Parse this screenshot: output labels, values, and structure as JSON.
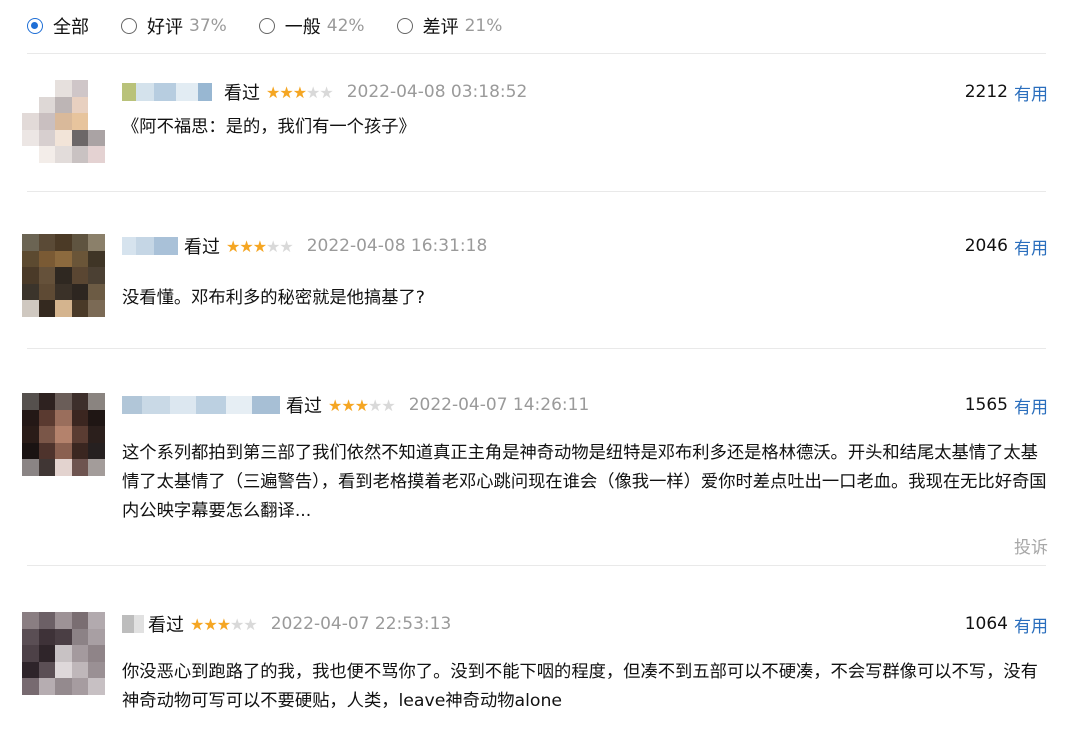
{
  "filters": [
    {
      "label": "全部",
      "pct": "",
      "checked": true
    },
    {
      "label": "好评",
      "pct": "37%",
      "checked": false
    },
    {
      "label": "一般",
      "pct": "42%",
      "checked": false
    },
    {
      "label": "差评",
      "pct": "21%",
      "checked": false
    }
  ],
  "accent_color": "#1f6fd6",
  "star_color": "#f5a623",
  "comments": [
    {
      "seen_label": "看过",
      "rating": 3,
      "time": "2022-04-08 03:18:52",
      "votes": "2212",
      "useful_label": "有用",
      "content": "《阿不福思：是的，我们有一个孩子》"
    },
    {
      "seen_label": "看过",
      "rating": 3,
      "time": "2022-04-08 16:31:18",
      "votes": "2046",
      "useful_label": "有用",
      "content": "没看懂。邓布利多的秘密就是他搞基了?"
    },
    {
      "seen_label": "看过",
      "rating": 3,
      "time": "2022-04-07 14:26:11",
      "votes": "1565",
      "useful_label": "有用",
      "content": "这个系列都拍到第三部了我们依然不知道真正主角是神奇动物是纽特是邓布利多还是格林德沃。开头和结尾太基情了太基情了太基情了（三遍警告），看到老格摸着老邓心跳问现在谁会（像我一样）爱你时差点吐出一口老血。我现在无比好奇国内公映字幕要怎么翻译...",
      "report_label": "投诉"
    },
    {
      "seen_label": "看过",
      "rating": 3,
      "time": "2022-04-07 22:53:13",
      "votes": "1064",
      "useful_label": "有用",
      "content": "你没恶心到跑路了的我，我也便不骂你了。没到不能下咽的程度，但凑不到五部可以不硬凑，不会写群像可以不写，没有神奇动物可写可以不要硬贴，人类，leave神奇动物alone"
    }
  ]
}
